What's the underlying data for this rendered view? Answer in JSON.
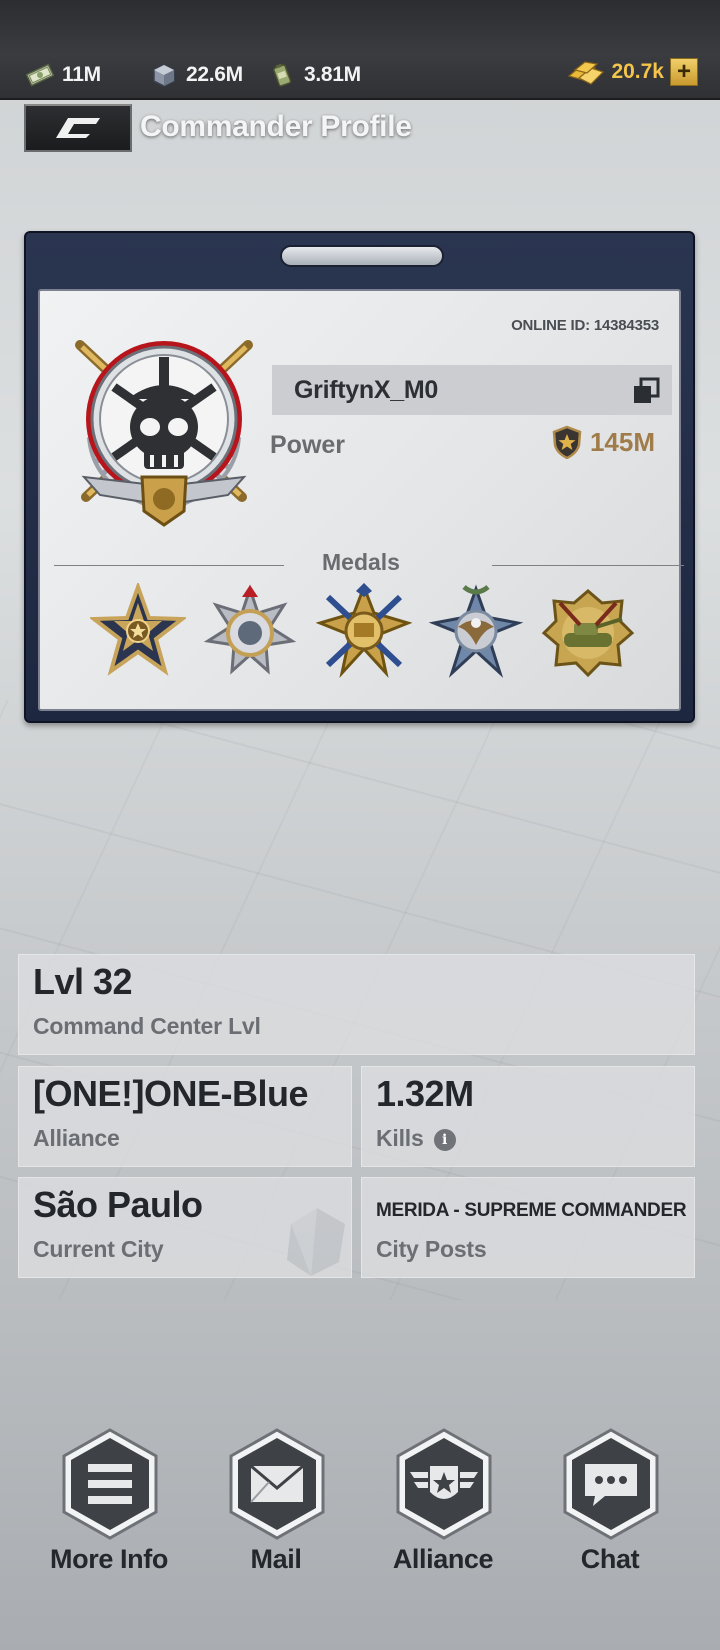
{
  "resources": [
    {
      "icon": "cash-icon",
      "value": "11M"
    },
    {
      "icon": "iron-icon",
      "value": "22.6M"
    },
    {
      "icon": "oil-icon",
      "value": "3.81M"
    }
  ],
  "gold": {
    "icon": "gold-icon",
    "value": "20.7k"
  },
  "header": {
    "title": "Commander Profile"
  },
  "profile": {
    "online_id": "ONLINE ID: 14384353",
    "name": "GriftynX_M0",
    "power_label": "Power",
    "power_value": "145M",
    "medals_label": "Medals"
  },
  "medals": [
    {
      "icon": "star-medal-icon"
    },
    {
      "icon": "silver-star-medal-icon"
    },
    {
      "icon": "gold-cross-medal-icon"
    },
    {
      "icon": "eagle-cross-medal-icon"
    },
    {
      "icon": "tank-medal-icon"
    }
  ],
  "stats": {
    "level": {
      "value": "Lvl 32",
      "label": "Command Center Lvl"
    },
    "alliance": {
      "value": "[ONE!]ONE-Blue",
      "label": "Alliance"
    },
    "kills": {
      "value": "1.32M",
      "label": "Kills"
    },
    "city": {
      "value": "São Paulo",
      "label": "Current City"
    },
    "posts": {
      "value": "MERIDA - SUPREME COMMANDER",
      "label": "City Posts"
    }
  },
  "nav": [
    {
      "icon": "menu-icon",
      "label": "More Info"
    },
    {
      "icon": "mail-icon",
      "label": "Mail"
    },
    {
      "icon": "alliance-icon",
      "label": "Alliance"
    },
    {
      "icon": "chat-icon",
      "label": "Chat"
    }
  ],
  "colors": {
    "card_frame": "#243050",
    "gold_text": "#f4c54a",
    "power_text": "#a07c4a"
  }
}
